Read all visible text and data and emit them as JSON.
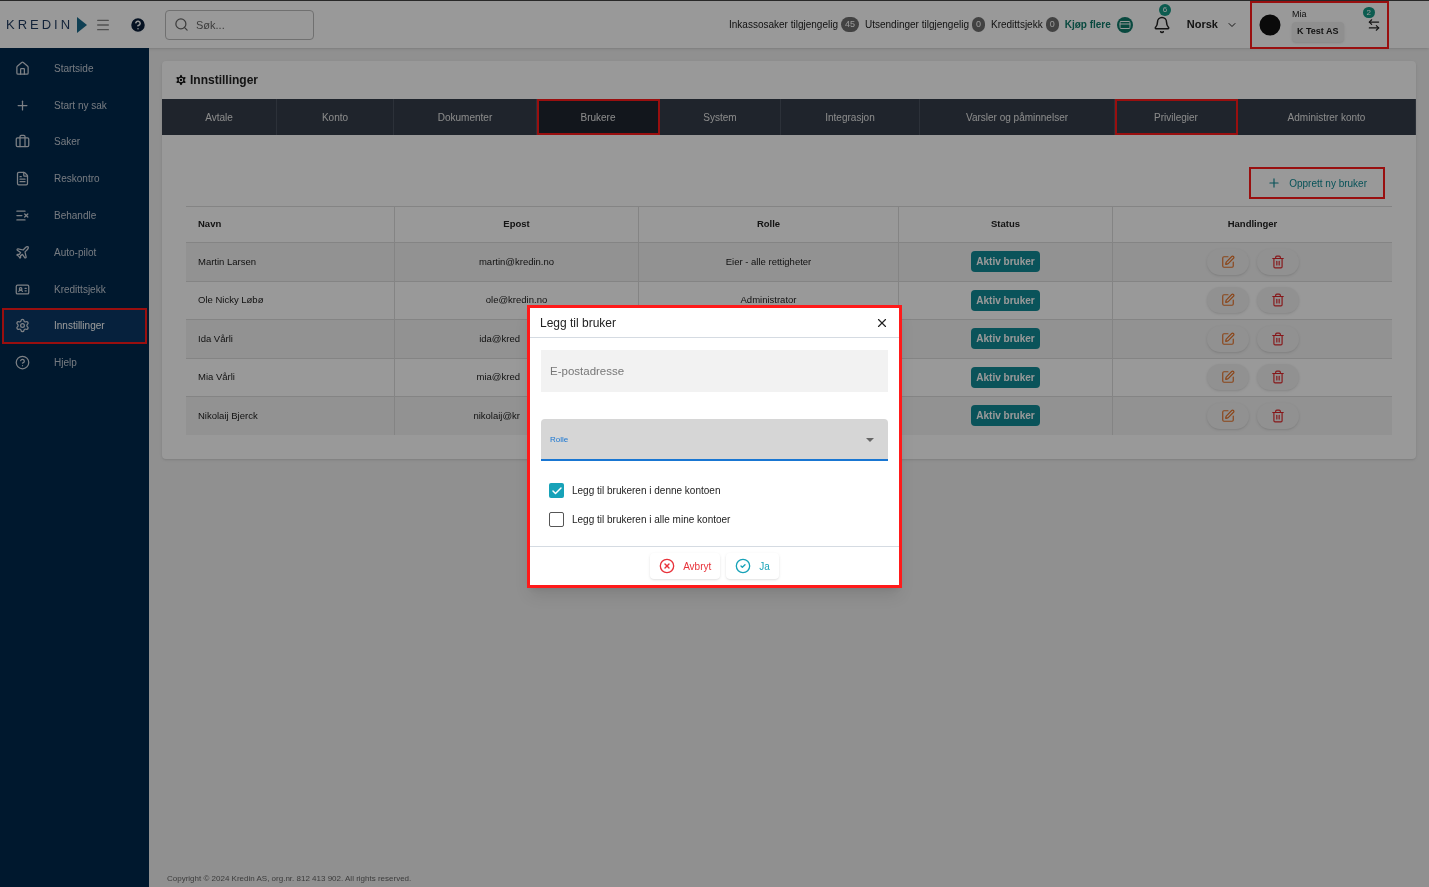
{
  "topbar": {
    "logo": "KREDIN",
    "search": {
      "placeholder": "Søk..."
    },
    "counters": [
      {
        "label": "Inkassosaker tilgjengelig",
        "count": "45"
      },
      {
        "label": "Utsendinger tilgjengelig",
        "count": "0"
      },
      {
        "label": "Kredittsjekk",
        "count": "0"
      }
    ],
    "buy_link": "Kjøp flere",
    "notifications": "6",
    "language": "Norsk",
    "user": {
      "name": "Mia",
      "account": "K Test AS",
      "switch_count": "2",
      "highlighted": true
    }
  },
  "sidebar": {
    "items": [
      {
        "label": "Startside",
        "selected": false,
        "highlighted": false
      },
      {
        "label": "Start ny sak",
        "selected": false,
        "highlighted": false
      },
      {
        "label": "Saker",
        "selected": false,
        "highlighted": false
      },
      {
        "label": "Reskontro",
        "selected": false,
        "highlighted": false
      },
      {
        "label": "Behandle",
        "selected": false,
        "highlighted": false
      },
      {
        "label": "Auto-pilot",
        "selected": false,
        "highlighted": false
      },
      {
        "label": "Kredittsjekk",
        "selected": false,
        "highlighted": false
      },
      {
        "label": "Innstillinger",
        "selected": true,
        "highlighted": true
      },
      {
        "label": "Hjelp",
        "selected": false,
        "highlighted": false
      }
    ]
  },
  "page": {
    "title": "Innstillinger",
    "tabs": [
      {
        "label": "Avtale",
        "selected": false,
        "highlighted": false
      },
      {
        "label": "Konto",
        "selected": false,
        "highlighted": false
      },
      {
        "label": "Dokumenter",
        "selected": false,
        "highlighted": false
      },
      {
        "label": "Brukere",
        "selected": true,
        "highlighted": true
      },
      {
        "label": "System",
        "selected": false,
        "highlighted": false
      },
      {
        "label": "Integrasjon",
        "selected": false,
        "highlighted": false
      },
      {
        "label": "Varsler og påminnelser",
        "selected": false,
        "highlighted": false
      },
      {
        "label": "Privilegier",
        "selected": false,
        "highlighted": true
      },
      {
        "label": "Administrer konto",
        "selected": false,
        "highlighted": false
      }
    ],
    "create_button": {
      "label": "Opprett ny bruker",
      "highlighted": true
    },
    "table": {
      "columns": [
        "Navn",
        "Epost",
        "Rolle",
        "Status",
        "Handlinger"
      ],
      "rows": [
        {
          "name": "Martin Larsen",
          "email": "martin@kredin.no",
          "role": "Eier - alle rettigheter",
          "status": "Aktiv bruker"
        },
        {
          "name": "Ole Nicky Løbø",
          "email": "ole@kredin.no",
          "role": "Administrator",
          "status": "Aktiv bruker"
        },
        {
          "name": "Ida Vårli",
          "email": "ida@kred",
          "status": "Aktiv bruker"
        },
        {
          "name": "Mia Vårli",
          "email": "mia@kred",
          "status": "Aktiv bruker"
        },
        {
          "name": "Nikolaij Bjerck",
          "email": "nikolaij@kr",
          "status": "Aktiv bruker"
        }
      ]
    }
  },
  "footer": "Copyright © 2024 Kredin AS, org.nr. 812 413 902. All rights reserved.",
  "dialog": {
    "title": "Legg til bruker",
    "highlighted": true,
    "email": {
      "placeholder": "E-postadresse"
    },
    "role": {
      "label": "Rolle"
    },
    "options": [
      {
        "label": "Legg til brukeren i denne kontoen",
        "checked": true
      },
      {
        "label": "Legg til brukeren i alle mine kontoer",
        "checked": false
      }
    ],
    "buttons": [
      {
        "label": "Avbryt",
        "kind": "cancel"
      },
      {
        "label": "Ja",
        "kind": "confirm"
      }
    ]
  }
}
